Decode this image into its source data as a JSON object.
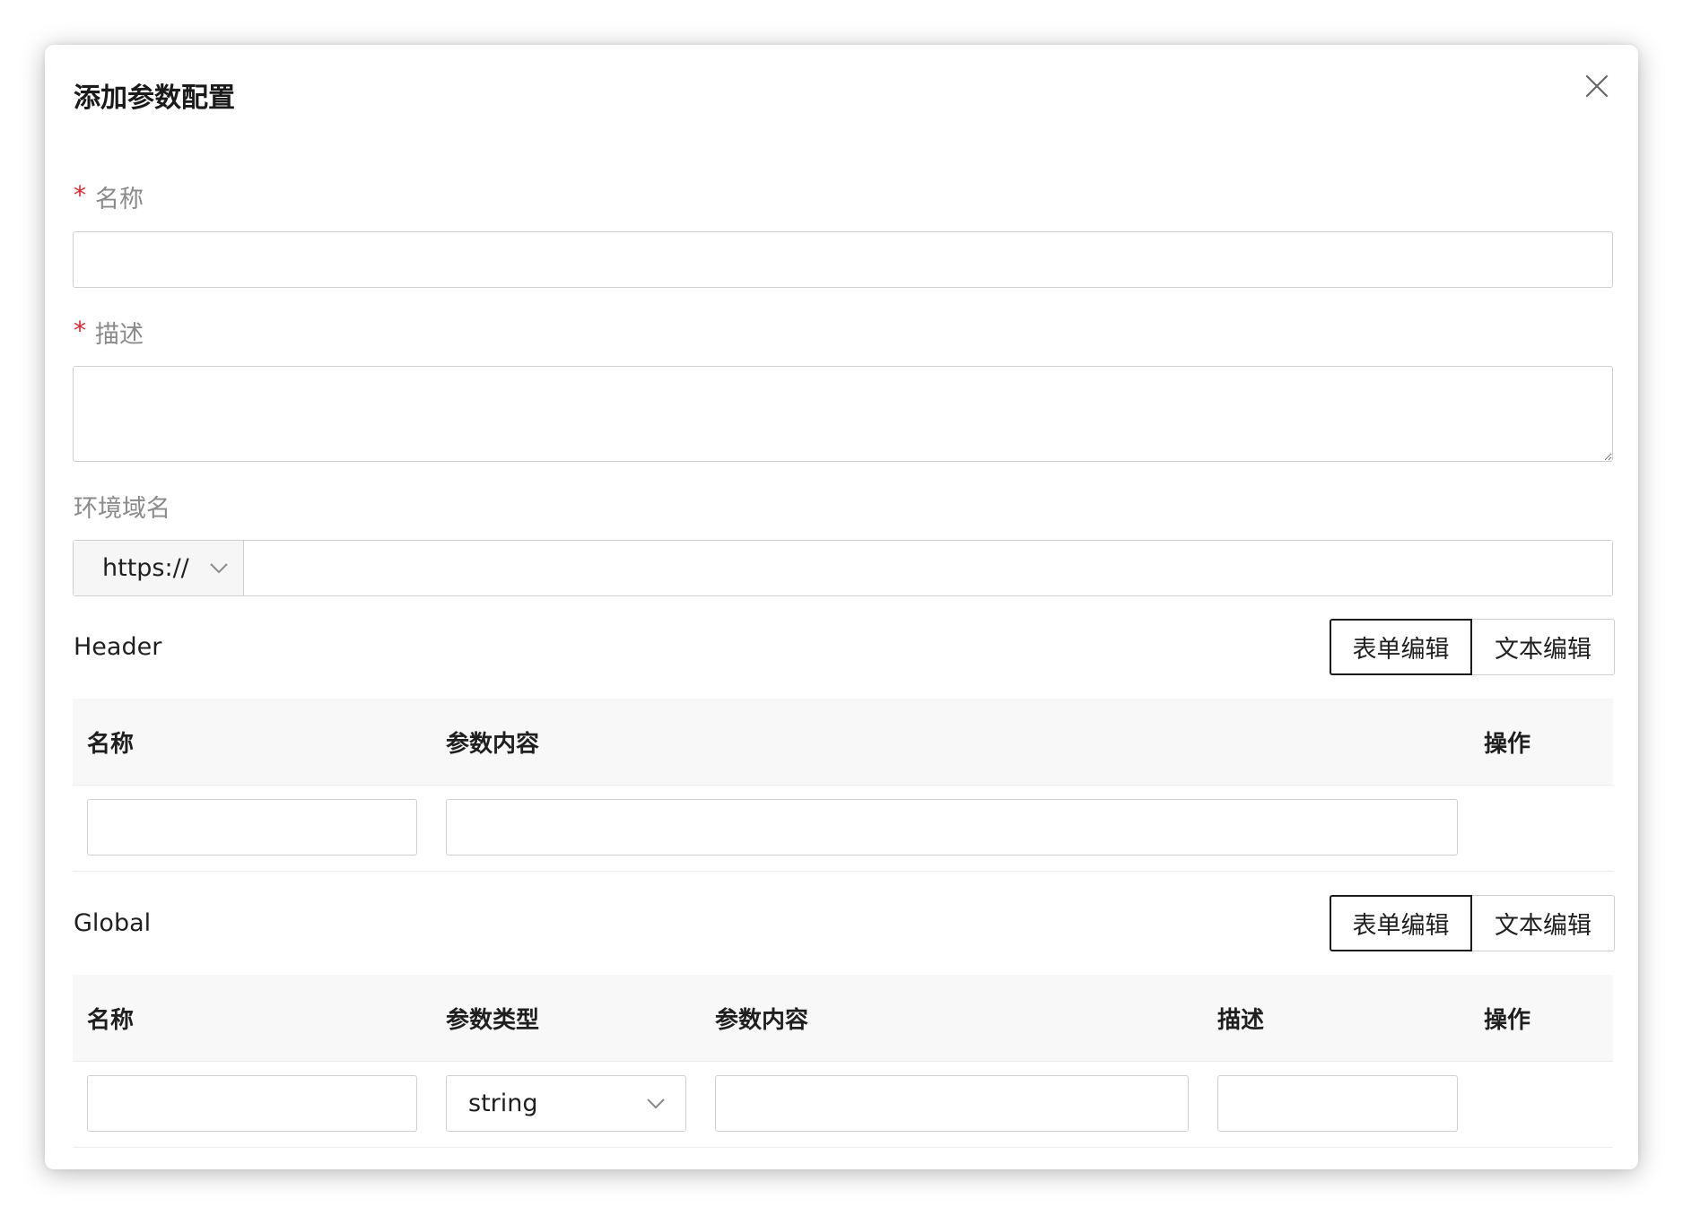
{
  "dialog": {
    "title": "添加参数配置",
    "close_label": "×"
  },
  "form": {
    "name": {
      "required_mark": "*",
      "label": "名称",
      "value": ""
    },
    "description": {
      "required_mark": "*",
      "label": "描述",
      "value": ""
    },
    "domain": {
      "label": "环境域名",
      "protocol": "https://",
      "value": ""
    }
  },
  "header_section": {
    "title": "Header",
    "form_edit_label": "表单编辑",
    "text_edit_label": "文本编辑",
    "columns": [
      "名称",
      "参数内容",
      "操作"
    ],
    "rows": [
      {
        "name": "",
        "content": ""
      }
    ]
  },
  "global_section": {
    "title": "Global",
    "form_edit_label": "表单编辑",
    "text_edit_label": "文本编辑",
    "columns": [
      "名称",
      "参数类型",
      "参数内容",
      "描述",
      "操作"
    ],
    "rows": [
      {
        "name": "",
        "type": "string",
        "content": "",
        "description": ""
      }
    ]
  },
  "colors": {
    "required": "#e0262c",
    "border": "#cfcfcf",
    "table_header_bg": "#f8f8f8"
  }
}
